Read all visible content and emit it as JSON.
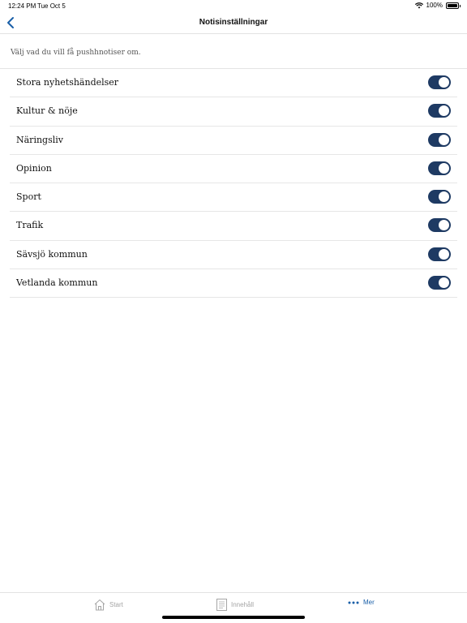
{
  "status_bar": {
    "time": "12:24 PM",
    "date": "Tue Oct 5",
    "battery": "100%"
  },
  "nav": {
    "title": "Notisinställningar"
  },
  "intro_text": "Välj vad du vill få pushhnotiser om.",
  "settings": [
    {
      "label": "Stora nyhetshändelser",
      "enabled": true
    },
    {
      "label": "Kultur & nöje",
      "enabled": true
    },
    {
      "label": "Näringsliv",
      "enabled": true
    },
    {
      "label": "Opinion",
      "enabled": true
    },
    {
      "label": "Sport",
      "enabled": true
    },
    {
      "label": "Trafik",
      "enabled": true
    },
    {
      "label": "Sävsjö kommun",
      "enabled": true
    },
    {
      "label": "Vetlanda kommun",
      "enabled": true
    }
  ],
  "tabs": [
    {
      "label": "Start",
      "icon": "home-icon",
      "active": false
    },
    {
      "label": "Innehåll",
      "icon": "list-icon",
      "active": false
    },
    {
      "label": "Mer",
      "icon": "more-icon",
      "active": true
    }
  ],
  "colors": {
    "toggle_on": "#1e3a63",
    "accent": "#1a5fa8",
    "inactive_tab": "#a5a5a5"
  }
}
